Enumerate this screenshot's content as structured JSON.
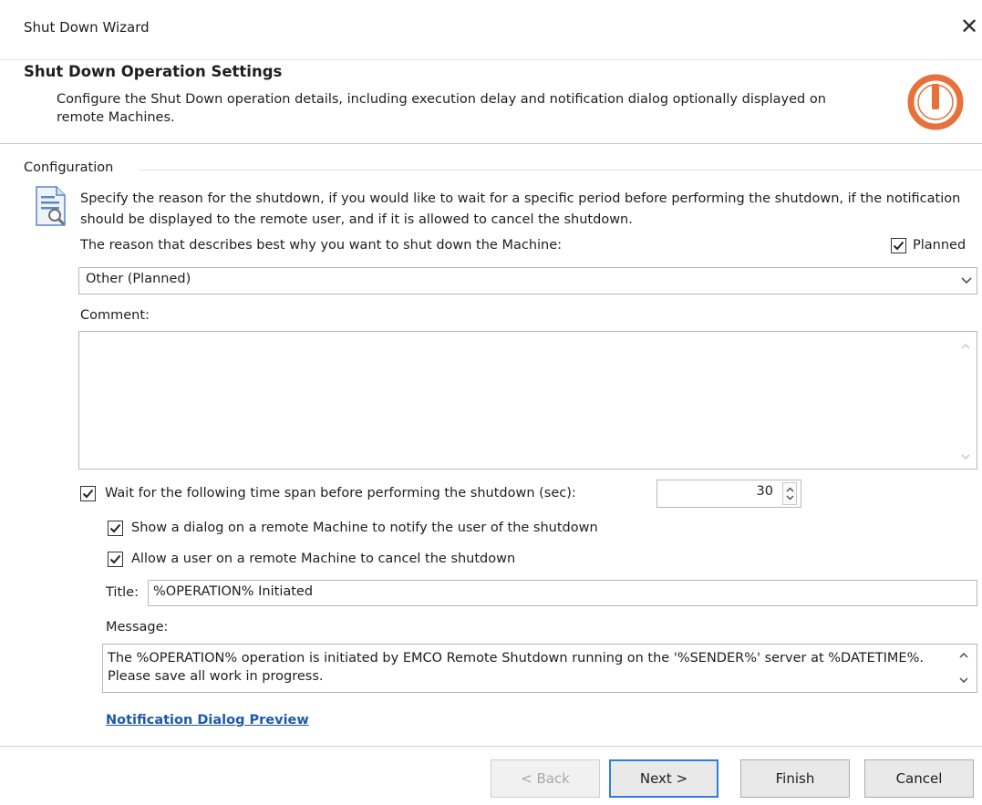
{
  "window": {
    "title": "Shut Down Wizard",
    "close_glyph": "✕"
  },
  "header": {
    "title": "Shut Down Operation Settings",
    "description": "Configure the Shut Down operation details, including execution delay and notification dialog optionally displayed on remote Machines.",
    "icon": "power-icon",
    "icon_color": "#e8703a"
  },
  "config": {
    "group_label": "Configuration",
    "icon": "document-search-icon",
    "instructions": "Specify the reason for the shutdown, if you would like to wait for a specific period before performing the shutdown, if the notification should be displayed to the remote user, and if it is allowed to cancel the shutdown.",
    "reason_label": "The reason that describes best why you want to shut down the Machine:",
    "planned_label": "Planned",
    "planned_checked": true,
    "reason_value": "Other (Planned)",
    "comment_label": "Comment:",
    "comment_value": "",
    "wait_label": "Wait for the following time span before performing the shutdown (sec):",
    "wait_checked": true,
    "wait_value": "30",
    "show_dialog_label": "Show a dialog on a remote Machine to notify the user of the shutdown",
    "show_dialog_checked": true,
    "allow_cancel_label": "Allow a user on a remote Machine to cancel the shutdown",
    "allow_cancel_checked": true,
    "title_label": "Title:",
    "title_value": "%OPERATION% Initiated",
    "message_label": "Message:",
    "message_value": "The %OPERATION% operation is initiated by EMCO Remote Shutdown running on the '%SENDER%' server at %DATETIME%. Please save all work in progress.",
    "preview_link": "Notification Dialog Preview"
  },
  "buttons": {
    "back": "< Back",
    "next": "Next >",
    "finish": "Finish",
    "cancel": "Cancel"
  }
}
